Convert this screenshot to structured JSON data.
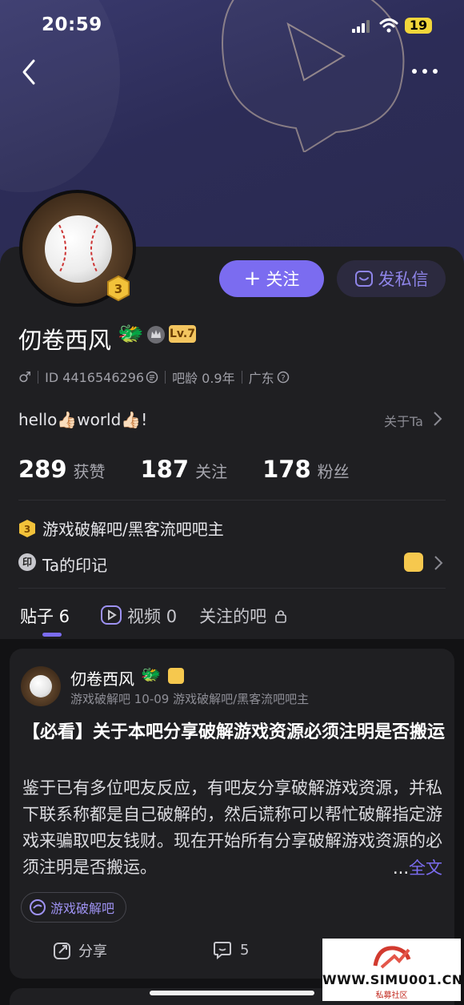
{
  "status_bar": {
    "time": "20:59",
    "battery": "19"
  },
  "profile": {
    "username": "仞卷西风",
    "level": "Lv.7",
    "admin_level": "3",
    "follow_label": "关注",
    "message_label": "发私信",
    "id_text": "ID 4416546296",
    "bar_age": "吧龄 0.9年",
    "location": "广东",
    "bio": "hello👍🏻world👍🏻!",
    "about_label": "关于Ta",
    "stats": [
      {
        "num": "289",
        "label": "获赞"
      },
      {
        "num": "187",
        "label": "关注"
      },
      {
        "num": "178",
        "label": "粉丝"
      }
    ],
    "admin_text": "游戏破解吧/黑客流吧吧主",
    "seal_icon_char": "印",
    "seal_text": "Ta的印记"
  },
  "tabs": {
    "posts": "贴子 6",
    "videos": "视频 0",
    "followed_bars": "关注的吧"
  },
  "post": {
    "author": "仞卷西风",
    "meta": "游戏破解吧   10-09   游戏破解吧/黑客流吧吧主",
    "title": "【必看】关于本吧分享破解游戏资源必须注明是否搬运",
    "body": "鉴于已有多位吧友反应，有吧友分享破解游戏资源，并私下联系称都是自己破解的，然后谎称可以帮忙破解指定游戏来骗取吧友钱财。现在开始所有分享破解游戏资源的必须注明是否搬运。",
    "more_prefix": "...",
    "more_label": "全文",
    "tag": "游戏破解吧",
    "share_label": "分享",
    "comment_count": "5"
  },
  "watermark": {
    "text": "WWW.SIMU001.CN",
    "sub": "私募社区"
  },
  "colors": {
    "accent": "#7b6cf0",
    "banner": "#2c2c57",
    "gold": "#f6c84e"
  }
}
